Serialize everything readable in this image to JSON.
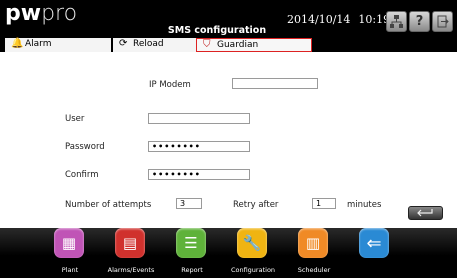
{
  "header": {
    "logo": {
      "part1": "pw",
      "part2": "pro"
    },
    "title": "SMS configuration",
    "date": "2014/10/14",
    "time": "10:19",
    "buttons": {
      "network_icon": "network-icon",
      "help_label": "?",
      "exit_icon": "exit-icon"
    }
  },
  "tabs": [
    {
      "label": "Alarm",
      "icon": "bell-icon"
    },
    {
      "label": "Reload",
      "icon": "reload-icon"
    },
    {
      "label": "Guardian",
      "icon": "guardian-icon"
    }
  ],
  "form": {
    "ip_modem": {
      "label": "IP Modem",
      "value": ""
    },
    "user": {
      "label": "User",
      "value": ""
    },
    "password": {
      "label": "Password",
      "value": "••••••••"
    },
    "confirm": {
      "label": "Confirm",
      "value": "••••••••"
    },
    "attempts": {
      "label": "Number of attempts",
      "value": "3"
    },
    "retry": {
      "label": "Retry after",
      "value": "1",
      "unit": "minutes"
    }
  },
  "footer": {
    "nav": [
      {
        "label": "Plant",
        "color": "#c054b6"
      },
      {
        "label": "Alarms/Events",
        "color": "#d0312d"
      },
      {
        "label": "Report",
        "color": "#5fb23a"
      },
      {
        "label": "Configuration",
        "color": "#f0b412"
      },
      {
        "label": "Scheduler",
        "color": "#f08a26"
      },
      {
        "label": "",
        "color": "#2a8ad4"
      }
    ]
  }
}
